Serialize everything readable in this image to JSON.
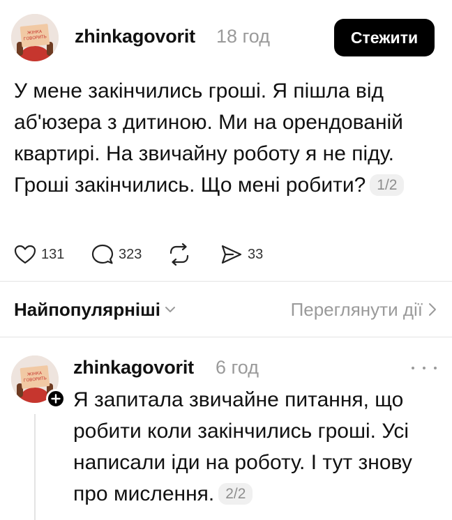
{
  "post": {
    "username": "zhinkagovorit",
    "time": "18 год",
    "follow_label": "Стежити",
    "text": "У мене закінчились гроші. Я пішла від аб'юзера з дитиною. Ми на орендованій квартирі. На звичайну роботу я не піду. Гроші закінчились. Що мені робити?",
    "counter": "1/2",
    "avatar_sign": [
      "ЖІНКА",
      "ГОВОРИТЬ"
    ]
  },
  "actions": {
    "likes": "131",
    "comments": "323",
    "reposts": "",
    "shares": "33",
    "icons": [
      "heart-icon",
      "comment-icon",
      "repost-icon",
      "share-icon"
    ]
  },
  "sort": {
    "label": "Найпопулярніші",
    "activity_label": "Переглянути дії"
  },
  "reply": {
    "username": "zhinkagovorit",
    "time": "6 год",
    "text": "Я запитала звичайне питання, що робити коли закінчились гроші. Усі написали іди на роботу. І тут знову про мислення.",
    "counter": "2/2"
  },
  "colors": {
    "accent": "#000000",
    "muted": "#9a9a9a",
    "divider": "#e3e3e3",
    "avatar_shirt": "#c6362e",
    "avatar_sign": "#f1c9a4"
  }
}
